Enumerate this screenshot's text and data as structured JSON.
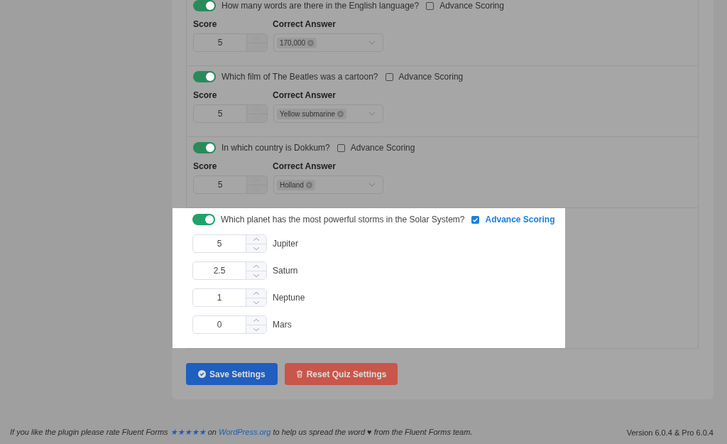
{
  "questions": [
    {
      "kind": "simple",
      "enabled": true,
      "question": "How many words are there in the English language?",
      "advance_scoring": false,
      "advance_label": "Advance Scoring",
      "highlighted": false,
      "score_label": "Score",
      "score": "5",
      "answer_label": "Correct Answer",
      "answers": [
        "170,000"
      ]
    },
    {
      "kind": "simple",
      "enabled": true,
      "question": "Which film of The Beatles was a cartoon?",
      "advance_scoring": false,
      "advance_label": "Advance Scoring",
      "highlighted": false,
      "score_label": "Score",
      "score": "5",
      "answer_label": "Correct Answer",
      "answers": [
        "Yellow submarine"
      ]
    },
    {
      "kind": "simple",
      "enabled": true,
      "question": "In which country is Dokkum?",
      "advance_scoring": false,
      "advance_label": "Advance Scoring",
      "highlighted": false,
      "score_label": "Score",
      "score": "5",
      "answer_label": "Correct Answer",
      "answers": [
        "Holland"
      ]
    },
    {
      "kind": "advanced",
      "enabled": true,
      "question": "Which planet has the most powerful storms in the Solar System?",
      "advance_scoring": true,
      "advance_label": "Advance Scoring",
      "highlighted": true,
      "options": [
        {
          "score": "5",
          "label": "Jupiter"
        },
        {
          "score": "2.5",
          "label": "Saturn"
        },
        {
          "score": "1",
          "label": "Neptune"
        },
        {
          "score": "0",
          "label": "Mars"
        }
      ]
    }
  ],
  "buttons": [
    {
      "kind": "save",
      "label": "Save Settings"
    },
    {
      "kind": "reset",
      "label": "Reset Quiz Settings"
    }
  ],
  "footer": {
    "text_before": "If you like the plugin please rate Fluent Forms",
    "rating_glyphs": "★★★★★",
    "text_middle": "on",
    "link": "WordPress.org",
    "text_after": "to help us spread the word",
    "heart": "♥",
    "text_end": "from the Fluent Forms team.",
    "version": "Version 6.0.4 & Pro 6.0.4"
  }
}
